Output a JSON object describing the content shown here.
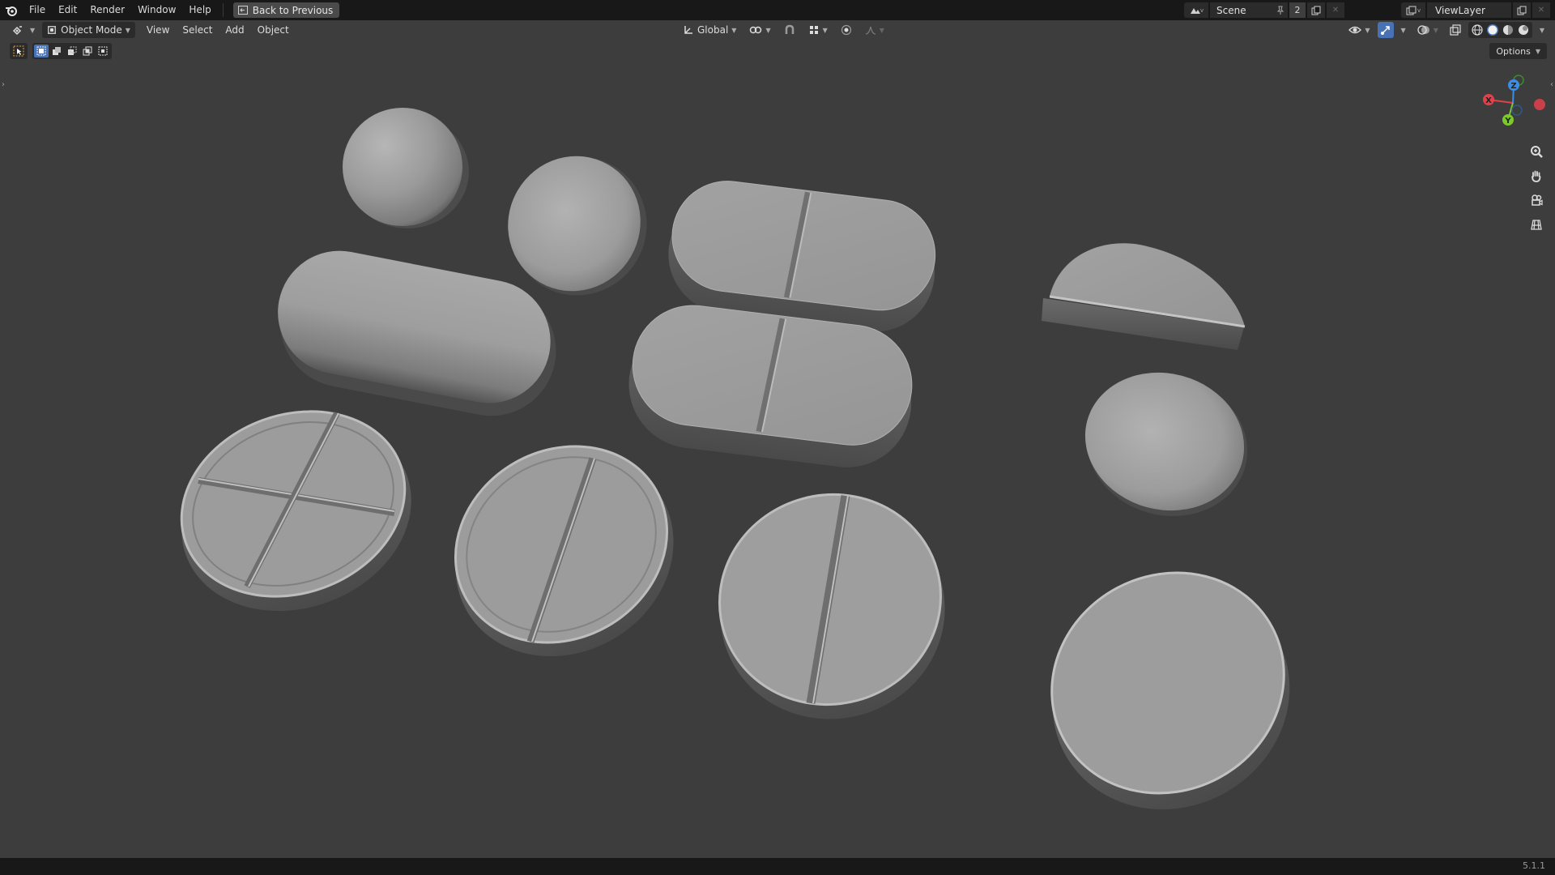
{
  "topbar": {
    "menus": [
      "File",
      "Edit",
      "Render",
      "Window",
      "Help"
    ],
    "back_button": "Back to Previous",
    "scene": {
      "name": "Scene",
      "user_count": "2"
    },
    "view_layer": "ViewLayer"
  },
  "viewport_header": {
    "mode": "Object Mode",
    "menus": [
      "View",
      "Select",
      "Add",
      "Object"
    ],
    "transform_orientation": "Global"
  },
  "tool_settings": {
    "options_label": "Options"
  },
  "gizmo": {
    "axes": {
      "x": "X",
      "y": "Y",
      "z": "Z"
    },
    "colors": {
      "x": "#e2414c",
      "y": "#7bc92a",
      "z": "#3a8ee6"
    }
  },
  "status_bar": {
    "version": "5.1.1"
  },
  "icons": [
    "blender-logo-icon",
    "editor-type-icon",
    "object-mode-icon",
    "select-box-icon",
    "transform-pivot-icon",
    "snap-icon",
    "proportional-edit-icon",
    "overlay-icon",
    "xray-icon",
    "solid-shading-icon",
    "material-shading-icon",
    "rendered-shading-icon",
    "wireframe-shading-icon",
    "zoom-icon",
    "pan-hand-icon",
    "camera-icon",
    "grid-ortho-icon"
  ]
}
